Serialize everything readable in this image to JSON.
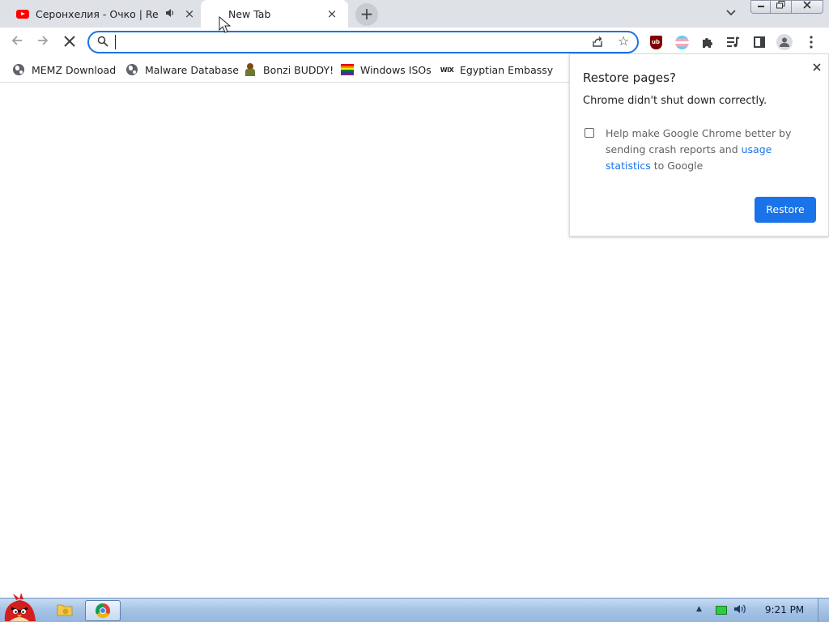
{
  "tabs": [
    {
      "title": "Серонхелия - Очко | Remix",
      "favicon": "youtube-icon",
      "audio": "speaker-icon",
      "active": false
    },
    {
      "title": "New Tab",
      "favicon": "none",
      "active": true
    }
  ],
  "toolbar": {
    "omnibox_value": "",
    "extensions": [
      "ublock-origin-icon",
      "transgender-flag-icon",
      "puzzle-piece-icon",
      "media-control-icon",
      "side-panel-icon",
      "profile-icon",
      "more-menu-icon"
    ],
    "ublock_label": "ub"
  },
  "bookmarks": [
    {
      "label": "MEMZ Download",
      "icon": "globe-icon"
    },
    {
      "label": "Malware Database",
      "icon": "globe-icon"
    },
    {
      "label": "Bonzi BUDDY!",
      "icon": "bonzi-icon"
    },
    {
      "label": "Windows ISOs",
      "icon": "rainbow-flag-icon"
    },
    {
      "label": "Egyptian Embassy",
      "icon": "wix-icon",
      "icon_text": "WIX"
    }
  ],
  "bubble": {
    "title": "Restore pages?",
    "message": "Chrome didn't shut down correctly.",
    "consent_text": "Help make Google Chrome better by sending crash reports and",
    "consent_link": "usage statistics",
    "consent_tail": "to Google",
    "consent_checked": false,
    "restore_label": "Restore"
  },
  "taskbar": {
    "clock": "9:21 PM",
    "pinned": [
      "folder-icon",
      "chrome-icon"
    ]
  },
  "colors": {
    "accent": "#1a73e8",
    "tabstrip": "#dee1e6",
    "taskbar": "#a7c4e6"
  }
}
